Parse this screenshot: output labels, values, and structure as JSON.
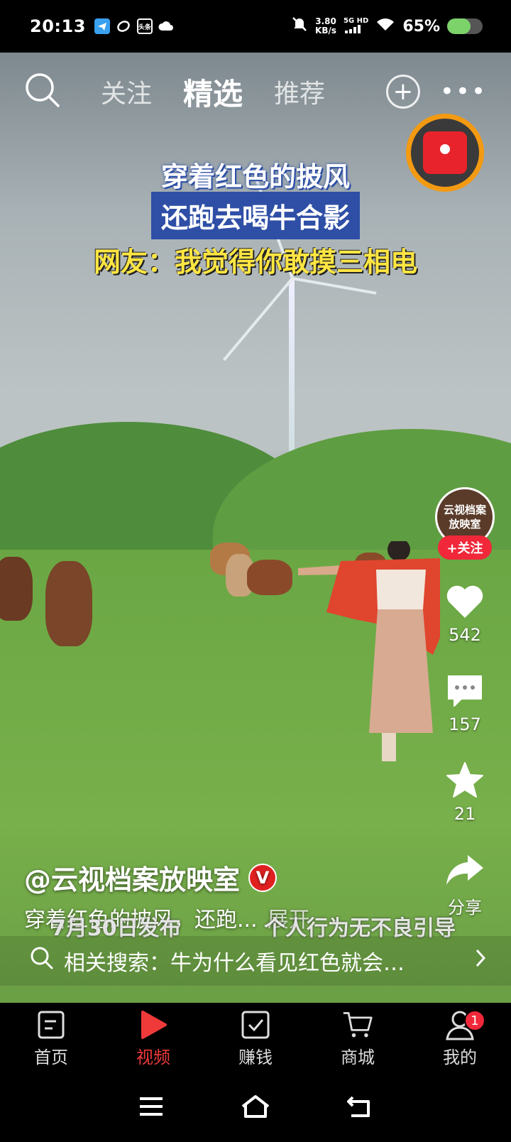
{
  "status_bar": {
    "time": "20:13",
    "net_speed_value": "3.80",
    "net_speed_unit": "KB/s",
    "network": "5G HD",
    "battery": "65%",
    "battery_level": 0.65
  },
  "top_nav": {
    "tabs": [
      {
        "label": "关注"
      },
      {
        "label": "精选"
      },
      {
        "label": "推荐"
      }
    ],
    "active_tab": "精选"
  },
  "video": {
    "caption_lines": [
      "穿着红色的披风",
      "还跑去喝牛合影",
      "网友：我觉得你敢摸三相电"
    ],
    "watermark_left": "7月30日发布",
    "watermark_right": "个人行为无不良引导"
  },
  "author": {
    "avatar_text": "云视档案放映室",
    "name": "@云视档案放映室",
    "verified_badge": "V",
    "follow_label": "+关注"
  },
  "actions": {
    "likes": "542",
    "comments": "157",
    "favorites": "21",
    "share_label": "分享"
  },
  "description": {
    "text": "穿着红色的披风，还跑...",
    "expand_label": "展开"
  },
  "related_search": {
    "label": "相关搜索：牛为什么看见红色就会…"
  },
  "bottom_nav": {
    "items": [
      {
        "label": "首页"
      },
      {
        "label": "视频"
      },
      {
        "label": "赚钱"
      },
      {
        "label": "商城"
      },
      {
        "label": "我的"
      }
    ],
    "active": "视频",
    "profile_badge": "1"
  },
  "colors": {
    "accent_red": "#f0283a",
    "packet_ring": "#f39a12",
    "caption_yellow": "#ffe642",
    "caption_blue": "#2f4fa6"
  }
}
